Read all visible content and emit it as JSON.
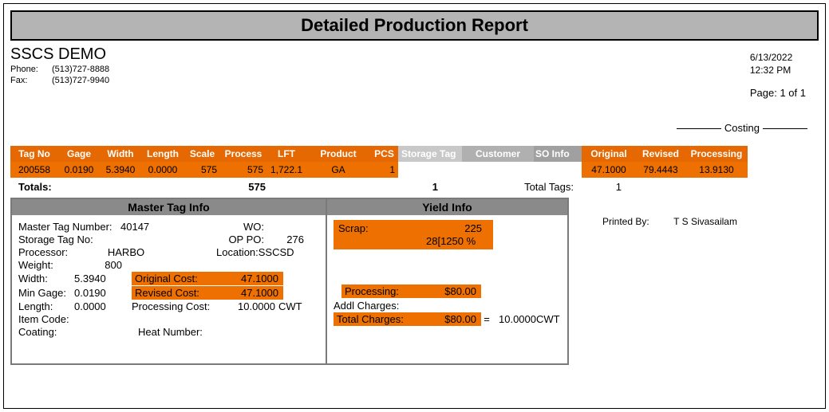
{
  "report": {
    "title": "Detailed Production Report",
    "company": "SSCS DEMO",
    "phone_label": "Phone:",
    "phone": "(513)727-8888",
    "fax_label": "Fax:",
    "fax": "(513)727-9940",
    "date": "6/13/2022",
    "time": "12:32 PM",
    "page_label": "Page: 1 of 1",
    "costing_label": "Costing",
    "printed_by_label": "Printed By:",
    "printed_by_value": "T S Sivasailam"
  },
  "headers": {
    "tag_no": "Tag No",
    "gage": "Gage",
    "width": "Width",
    "length": "Length",
    "scale": "Scale",
    "process": "Process",
    "lft": "LFT",
    "product": "Product",
    "pcs": "PCS",
    "storage_tag": "Storage Tag",
    "customer": "Customer",
    "so_info": "SO Info",
    "original": "Original",
    "revised": "Revised",
    "processing": "Processing"
  },
  "row": {
    "tag_no": "200558",
    "gage": "0.0190",
    "width": "5.3940",
    "length": "0.0000",
    "scale": "575",
    "process": "575",
    "lft": "1,722.1",
    "product": "GA",
    "pcs": "1",
    "storage_tag": "",
    "customer": "",
    "so_info": "",
    "original": "47.1000",
    "revised": "79.4443",
    "processing": "13.9130"
  },
  "totals": {
    "label": "Totals:",
    "scale": "575",
    "pcs": "1",
    "total_tags_label": "Total Tags:",
    "total_tags": "1"
  },
  "master": {
    "panel_title": "Master Tag Info",
    "master_tag_label": "Master Tag Number:",
    "master_tag_value": "40147",
    "wo_label": "WO:",
    "wo_value": "",
    "storage_tag_label": "Storage Tag No:",
    "storage_tag_value": "",
    "oppo_label": "OP PO:",
    "oppo_value": "276",
    "processor_label": "Processor:",
    "processor_value": "HARBO",
    "location_label": "Location:",
    "location_value": "SSCSD",
    "weight_label": "Weight:",
    "weight_value": "800",
    "width_label": "Width:",
    "width_value": "5.3940",
    "orig_cost_label": "Original Cost:",
    "orig_cost_value": "47.1000",
    "min_gage_label": "Min Gage:",
    "min_gage_value": "0.0190",
    "rev_cost_label": "Revised Cost:",
    "rev_cost_value": "47.1000",
    "length_label": "Length:",
    "length_value": "0.0000",
    "proc_cost_label": "Processing Cost:",
    "proc_cost_value": "10.0000",
    "proc_cost_unit": "CWT",
    "item_code_label": "Item Code:",
    "item_code_value": "",
    "coating_label": "Coating:",
    "coating_value": "",
    "heat_label": "Heat Number:",
    "heat_value": ""
  },
  "yield": {
    "panel_title": "Yield Info",
    "scrap_label": "Scrap:",
    "scrap_value": "225",
    "scrap_pct_prefix": "28[",
    "scrap_pct": "1250 %",
    "processing_label": "Processing:",
    "processing_value": "$80.00",
    "addl_label": "Addl Charges:",
    "total_label": "Total Charges:",
    "total_value": "$80.00",
    "equals": "=",
    "total_cwt_value": "10.0000",
    "total_cwt_unit": "CWT"
  }
}
